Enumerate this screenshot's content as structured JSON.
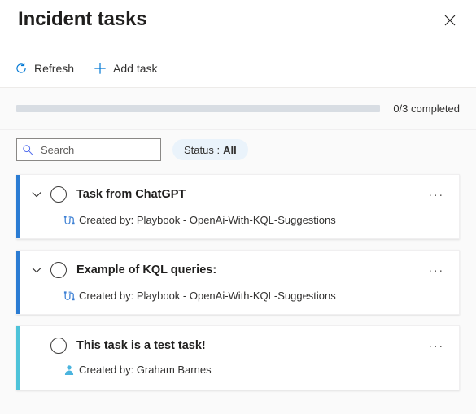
{
  "header": {
    "title": "Incident tasks",
    "close_icon": "close-icon",
    "commands": [
      {
        "label": "Refresh",
        "icon": "refresh-icon"
      },
      {
        "label": "Add task",
        "icon": "plus-icon"
      }
    ]
  },
  "progress": {
    "completed": 0,
    "total": 3,
    "percent": 0,
    "label": "0/3 completed"
  },
  "filters": {
    "search": {
      "placeholder": "Search",
      "value": "",
      "icon": "search-icon"
    },
    "status": {
      "label": "Status :",
      "value": "All"
    }
  },
  "colors": {
    "accent_blue": "#2b7cd3",
    "accent_cyan": "#4ec3d9",
    "primary": "#0078d4",
    "pill_bg": "#eaf3fb",
    "track": "#d8dde3"
  },
  "tasks": [
    {
      "title": "Task from ChatGPT",
      "accent": "#2b7cd3",
      "has_chevron": true,
      "chevron_icon": "chevron-down-icon",
      "checked": false,
      "meta_icon": "playbook-icon",
      "meta_text": "Created by: Playbook - OpenAi-With-KQL-Suggestions",
      "more_label": "···"
    },
    {
      "title": "Example of KQL queries:",
      "accent": "#2b7cd3",
      "has_chevron": true,
      "chevron_icon": "chevron-down-icon",
      "checked": false,
      "meta_icon": "playbook-icon",
      "meta_text": "Created by: Playbook - OpenAi-With-KQL-Suggestions",
      "more_label": "···"
    },
    {
      "title": "This task is a test task!",
      "accent": "#4ec3d9",
      "has_chevron": false,
      "chevron_icon": "",
      "checked": false,
      "meta_icon": "person-icon",
      "meta_text": "Created by: Graham Barnes",
      "more_label": "···"
    }
  ]
}
